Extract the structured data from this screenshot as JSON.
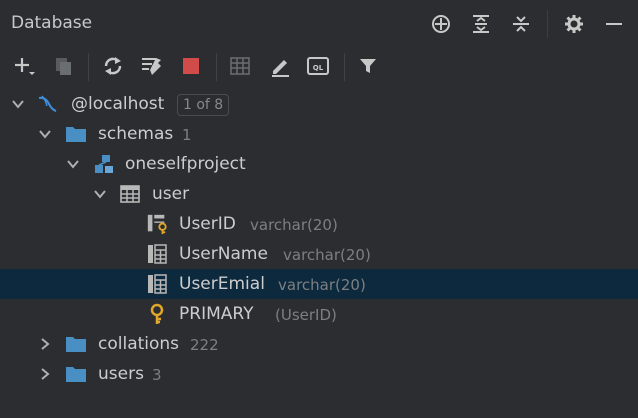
{
  "panel": {
    "title": "Database"
  },
  "header_icons": [
    "crosshair-icon",
    "expand-all-icon",
    "collapse-all-icon",
    "gear-icon",
    "minimize-icon"
  ],
  "toolbar_icons": [
    "add-icon",
    "duplicate-icon",
    "refresh-icon",
    "sync-schema-icon",
    "stop-icon",
    "table-editor-icon",
    "edit-icon",
    "query-console-icon",
    "filter-icon"
  ],
  "colors": {
    "background": "#2b2d30",
    "selection": "#0d293e",
    "folder": "#4a8fc4",
    "key": "#e0a72a",
    "stop": "#d24b4b",
    "dolphin": "#3d8fdb"
  },
  "tree": {
    "connection": {
      "label": "@localhost",
      "badge": "1 of 8"
    },
    "schemas": {
      "label": "schemas",
      "count": "1"
    },
    "schema": {
      "label": "oneselfproject"
    },
    "table": {
      "label": "user"
    },
    "columns": [
      {
        "name": "UserID",
        "type": "varchar(20)"
      },
      {
        "name": "UserName",
        "type": "varchar(20)"
      },
      {
        "name": "UserEmial",
        "type": "varchar(20)"
      }
    ],
    "index": {
      "name": "PRIMARY",
      "detail": "(UserID)"
    },
    "collations": {
      "label": "collations",
      "count": "222"
    },
    "users": {
      "label": "users",
      "count": "3"
    }
  }
}
